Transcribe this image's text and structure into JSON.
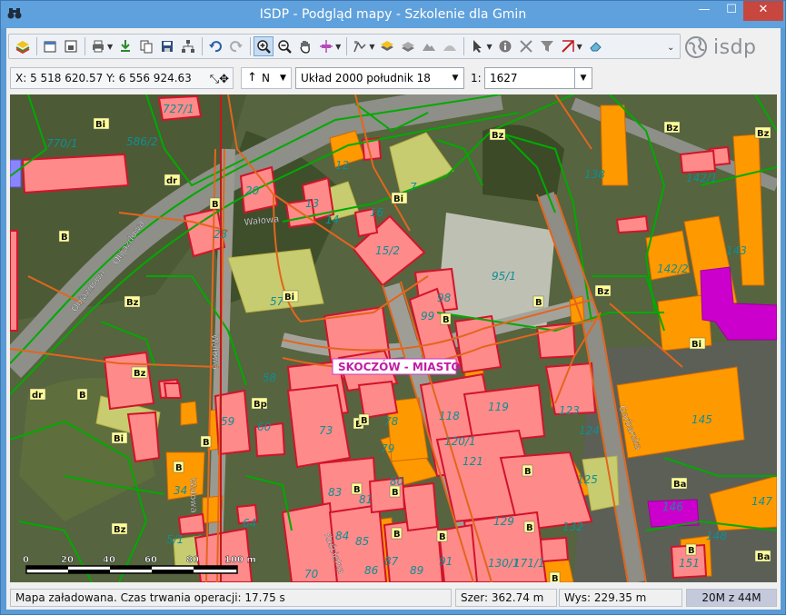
{
  "window": {
    "title": "ISDP - Podgląd mapy - Szkolenie dla Gmin",
    "minimize": "—",
    "maximize": "☐",
    "close": "✕"
  },
  "toolbar": {
    "logo_text": "isdp",
    "more": "⌄"
  },
  "coordbar": {
    "coords": "X: 5 518 620.57   Y: 6 556 924.63",
    "north_label": "N",
    "crs": "Układ 2000 południk 18",
    "scale_prefix": "1:",
    "scale_value": "1627"
  },
  "map": {
    "place_label": "SKOCZÓW - MIASTO",
    "streets": [
      "Objazdowa",
      "Objazdowa",
      "Wałowa",
      "Wałowa",
      "Wałowa",
      "Kościelna",
      "Garbarska"
    ],
    "scale_ticks": [
      "0",
      "20",
      "40",
      "60",
      "80",
      "100 m"
    ],
    "parcels": [
      {
        "t": "727/1"
      },
      {
        "t": "586/2"
      },
      {
        "t": "770/1"
      },
      {
        "t": "12"
      },
      {
        "t": "13"
      },
      {
        "t": "14"
      },
      {
        "t": "16"
      },
      {
        "t": "15/2"
      },
      {
        "t": "7"
      },
      {
        "t": "20"
      },
      {
        "t": "23"
      },
      {
        "t": "95/1"
      },
      {
        "t": "57"
      },
      {
        "t": "99"
      },
      {
        "t": "142/1"
      },
      {
        "t": "142/2"
      },
      {
        "t": "143"
      },
      {
        "t": "138"
      },
      {
        "t": "145"
      },
      {
        "t": "59"
      },
      {
        "t": "60"
      },
      {
        "t": "34"
      },
      {
        "t": "73"
      },
      {
        "t": "78"
      },
      {
        "t": "79"
      },
      {
        "t": "118"
      },
      {
        "t": "120/1"
      },
      {
        "t": "121"
      },
      {
        "t": "119"
      },
      {
        "t": "123"
      },
      {
        "t": "124"
      },
      {
        "t": "125"
      },
      {
        "t": "129"
      },
      {
        "t": "130/1"
      },
      {
        "t": "132"
      },
      {
        "t": "83"
      },
      {
        "t": "84"
      },
      {
        "t": "85"
      },
      {
        "t": "86"
      },
      {
        "t": "87"
      },
      {
        "t": "89"
      },
      {
        "t": "91"
      },
      {
        "t": "80"
      },
      {
        "t": "81"
      },
      {
        "t": "64"
      },
      {
        "t": "70"
      },
      {
        "t": "146"
      },
      {
        "t": "147"
      },
      {
        "t": "148"
      },
      {
        "t": "151"
      },
      {
        "t": "171/1"
      },
      {
        "t": "5/1"
      },
      {
        "t": "58"
      },
      {
        "t": "98"
      }
    ],
    "badges": [
      "Bi",
      "Bz",
      "B",
      "dr",
      "Bz",
      "Bi",
      "B",
      "Bz",
      "Bi",
      "Bz",
      "Bi",
      "Bp",
      "B",
      "B",
      "Bi",
      "B",
      "B",
      "Bz",
      "dr",
      "B",
      "B",
      "Ba",
      "Ba",
      "B",
      "B",
      "B",
      "B",
      "B",
      "B",
      "Bz",
      "B",
      "B",
      "B",
      "Bz"
    ]
  },
  "status": {
    "message": "Mapa załadowana. Czas trwania operacji: 17.75 s",
    "width": "Szer: 362.74 m",
    "height": "Wys: 229.35 m",
    "memory": "20M z 44M"
  },
  "colors": {
    "titlebar": "#5fa1dc",
    "building_pink": "#ff8a8a",
    "building_orange": "#ff9900",
    "building_green": "#c8cc70",
    "building_magenta": "#cc00cc",
    "parcel_line": "#00aa00",
    "road_line": "#e2661d",
    "badge_fill": "#ffff99"
  }
}
